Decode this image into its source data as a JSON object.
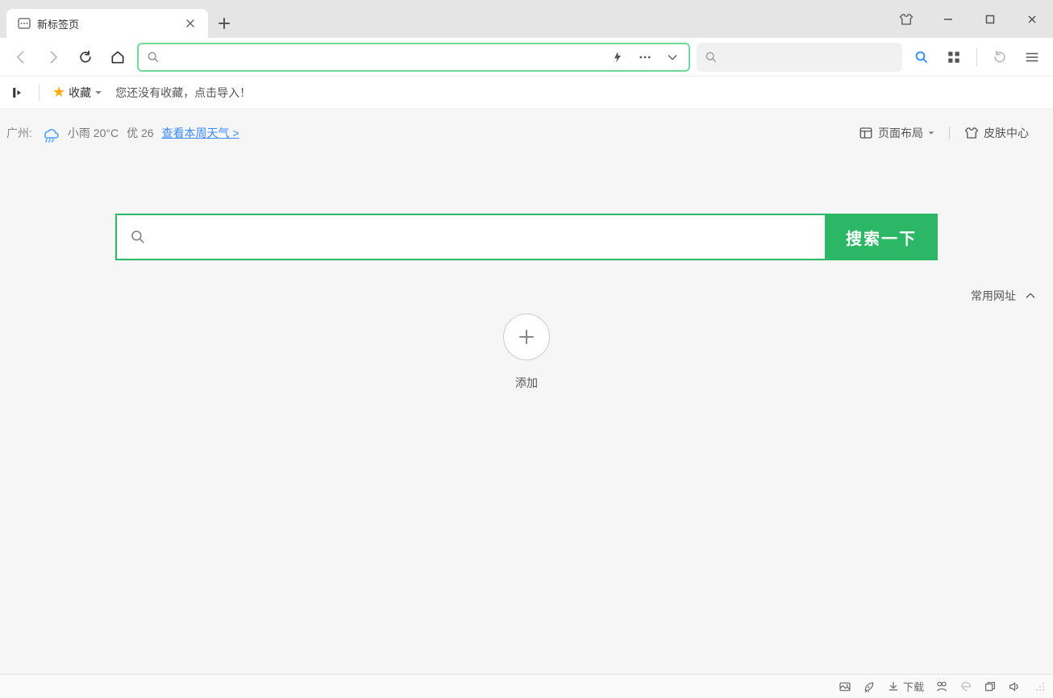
{
  "window": {
    "tab_title": "新标签页"
  },
  "bookmark": {
    "fav_label": "收藏",
    "hint": "您还没有收藏，点击导入！"
  },
  "weather": {
    "city_label": "广州:",
    "condition": "小雨 20°C",
    "aqi": "优 26",
    "link": "查看本周天气 >"
  },
  "page_controls": {
    "layout_label": "页面布局",
    "skin_label": "皮肤中心"
  },
  "big_search": {
    "button": "搜索一下"
  },
  "frequent": {
    "title": "常用网址"
  },
  "add_tile": {
    "label": "添加"
  },
  "status": {
    "download": "下载"
  }
}
